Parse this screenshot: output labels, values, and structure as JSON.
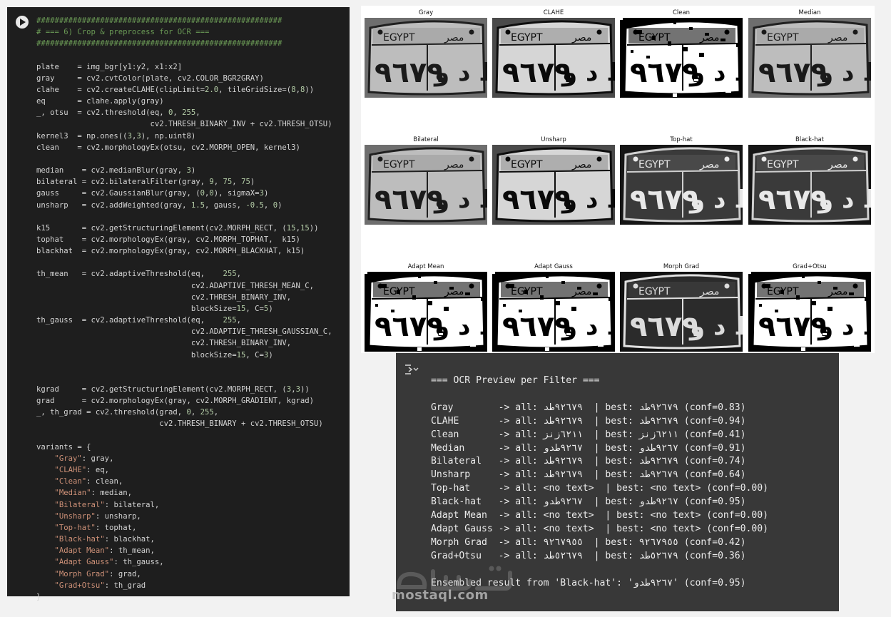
{
  "code_cell": {
    "lines": [
      {
        "t": "comment",
        "s": "######################################################"
      },
      {
        "t": "comment",
        "s": "# === 6) Crop & preprocess for OCR ==="
      },
      {
        "t": "comment",
        "s": "######################################################"
      },
      {
        "t": "code",
        "s": ""
      },
      {
        "t": "code",
        "s": "plate    = img_bgr[y1:y2, x1:x2]"
      },
      {
        "t": "code",
        "s": "gray     = cv2.cvtColor(plate, cv2.COLOR_BGR2GRAY)"
      },
      {
        "t": "code",
        "s": "clahe    = cv2.createCLAHE(clipLimit=2.0, tileGridSize=(8,8))"
      },
      {
        "t": "code",
        "s": "eq       = clahe.apply(gray)"
      },
      {
        "t": "code",
        "s": "_, otsu  = cv2.threshold(eq, 0, 255,"
      },
      {
        "t": "code",
        "s": "                         cv2.THRESH_BINARY_INV + cv2.THRESH_OTSU)"
      },
      {
        "t": "code",
        "s": "kernel3  = np.ones((3,3), np.uint8)"
      },
      {
        "t": "code",
        "s": "clean    = cv2.morphologyEx(otsu, cv2.MORPH_OPEN, kernel3)"
      },
      {
        "t": "code",
        "s": ""
      },
      {
        "t": "code",
        "s": "median    = cv2.medianBlur(gray, 3)"
      },
      {
        "t": "code",
        "s": "bilateral = cv2.bilateralFilter(gray, 9, 75, 75)"
      },
      {
        "t": "code",
        "s": "gauss     = cv2.GaussianBlur(gray, (0,0), sigmaX=3)"
      },
      {
        "t": "code",
        "s": "unsharp   = cv2.addWeighted(gray, 1.5, gauss, -0.5, 0)"
      },
      {
        "t": "code",
        "s": ""
      },
      {
        "t": "code",
        "s": "k15       = cv2.getStructuringElement(cv2.MORPH_RECT, (15,15))"
      },
      {
        "t": "code",
        "s": "tophat    = cv2.morphologyEx(gray, cv2.MORPH_TOPHAT,  k15)"
      },
      {
        "t": "code",
        "s": "blackhat  = cv2.morphologyEx(gray, cv2.MORPH_BLACKHAT, k15)"
      },
      {
        "t": "code",
        "s": ""
      },
      {
        "t": "code",
        "s": "th_mean   = cv2.adaptiveThreshold(eq,    255,"
      },
      {
        "t": "code",
        "s": "                                  cv2.ADAPTIVE_THRESH_MEAN_C,"
      },
      {
        "t": "code",
        "s": "                                  cv2.THRESH_BINARY_INV,"
      },
      {
        "t": "code",
        "s": "                                  blockSize=15, C=5)"
      },
      {
        "t": "code",
        "s": "th_gauss  = cv2.adaptiveThreshold(eq,    255,"
      },
      {
        "t": "code",
        "s": "                                  cv2.ADAPTIVE_THRESH_GAUSSIAN_C,"
      },
      {
        "t": "code",
        "s": "                                  cv2.THRESH_BINARY_INV,"
      },
      {
        "t": "code",
        "s": "                                  blockSize=15, C=3)"
      },
      {
        "t": "code",
        "s": ""
      },
      {
        "t": "code",
        "s": ""
      },
      {
        "t": "code",
        "s": "kgrad     = cv2.getStructuringElement(cv2.MORPH_RECT, (3,3))"
      },
      {
        "t": "code",
        "s": "grad      = cv2.morphologyEx(gray, cv2.MORPH_GRADIENT, kgrad)"
      },
      {
        "t": "code",
        "s": "_, th_grad = cv2.threshold(grad, 0, 255,"
      },
      {
        "t": "code",
        "s": "                           cv2.THRESH_BINARY + cv2.THRESH_OTSU)"
      },
      {
        "t": "code",
        "s": ""
      },
      {
        "t": "code",
        "s": "variants = {"
      },
      {
        "t": "code",
        "s": "    \"Gray\": gray,"
      },
      {
        "t": "code",
        "s": "    \"CLAHE\": eq,"
      },
      {
        "t": "code",
        "s": "    \"Clean\": clean,"
      },
      {
        "t": "code",
        "s": "    \"Median\": median,"
      },
      {
        "t": "code",
        "s": "    \"Bilateral\": bilateral,"
      },
      {
        "t": "code",
        "s": "    \"Unsharp\": unsharp,"
      },
      {
        "t": "code",
        "s": "    \"Top-hat\": tophat,"
      },
      {
        "t": "code",
        "s": "    \"Black-hat\": blackhat,"
      },
      {
        "t": "code",
        "s": "    \"Adapt Mean\": th_mean,"
      },
      {
        "t": "code",
        "s": "    \"Adapt Gauss\": th_gauss,"
      },
      {
        "t": "code",
        "s": "    \"Morph Grad\": grad,"
      },
      {
        "t": "code",
        "s": "    \"Grad+Otsu\": th_grad"
      },
      {
        "t": "code",
        "s": "}"
      }
    ]
  },
  "figure": {
    "panels": [
      {
        "title": "Gray",
        "style": "gray"
      },
      {
        "title": "CLAHE",
        "style": "clahe"
      },
      {
        "title": "Clean",
        "style": "binary"
      },
      {
        "title": "Median",
        "style": "gray"
      },
      {
        "title": "Bilateral",
        "style": "gray"
      },
      {
        "title": "Unsharp",
        "style": "clahe"
      },
      {
        "title": "Top-hat",
        "style": "dark"
      },
      {
        "title": "Black-hat",
        "style": "dark"
      },
      {
        "title": "Adapt Mean",
        "style": "binary"
      },
      {
        "title": "Adapt Gauss",
        "style": "binary"
      },
      {
        "title": "Morph Grad",
        "style": "edge"
      },
      {
        "title": "Grad+Otsu",
        "style": "binary"
      }
    ],
    "plate": {
      "top_text": "EGYPT",
      "arabic_top": "مصر",
      "digits": "٩٦٧٩",
      "letters": "ط د و"
    }
  },
  "output_cell": {
    "lines": [
      "=== OCR Preview per Filter ===",
      "",
      "Gray        -> all: ٩٢٦٧٩طد  | best: ٩٢٦٧٩طد (conf=0.83)",
      "CLAHE       -> all: ٩٢٦٧٩طد  | best: ٩٢٦٧٩طد (conf=0.94)",
      "Clean       -> all: ٦٢١١زنز  | best: ٦٢١١زنز (conf=0.41)",
      "Median      -> all: ٩٢٦٧طدو  | best: ٩٢٦٧طدو (conf=0.91)",
      "Bilateral   -> all: ٩٢٦٧٩طد  | best: ٩٢٦٧٩طد (conf=0.74)",
      "Unsharp     -> all: ٩٢٦٧٩طد  | best: ٩٢٦٧٩طد (conf=0.64)",
      "Top-hat     -> all: <no text>  | best: <no text> (conf=0.00)",
      "Black-hat   -> all: ٩٢٦٧طدو  | best: ٩٢٦٧طدو (conf=0.95)",
      "Adapt Mean  -> all: <no text>  | best: <no text> (conf=0.00)",
      "Adapt Gauss -> all: <no text>  | best: <no text> (conf=0.00)",
      "Morph Grad  -> all: ٩٢٦٧٩٥٥  | best: ٩٢٦٧٩٥٥ (conf=0.42)",
      "Grad+Otsu   -> all: ٥٢٦٧٩طد  | best: ٥٢٦٧٩طد (conf=0.36)",
      "",
      "Ensembled result from 'Black-hat': '٩٢٦٧طدو' (conf=0.95)"
    ]
  },
  "watermark": {
    "text": "mostaql.com"
  },
  "colors": {
    "code_bg": "#1e1e1e",
    "comment": "#6a9955",
    "number": "#b5cea8",
    "string": "#ce9178",
    "output_bg": "#383838"
  }
}
